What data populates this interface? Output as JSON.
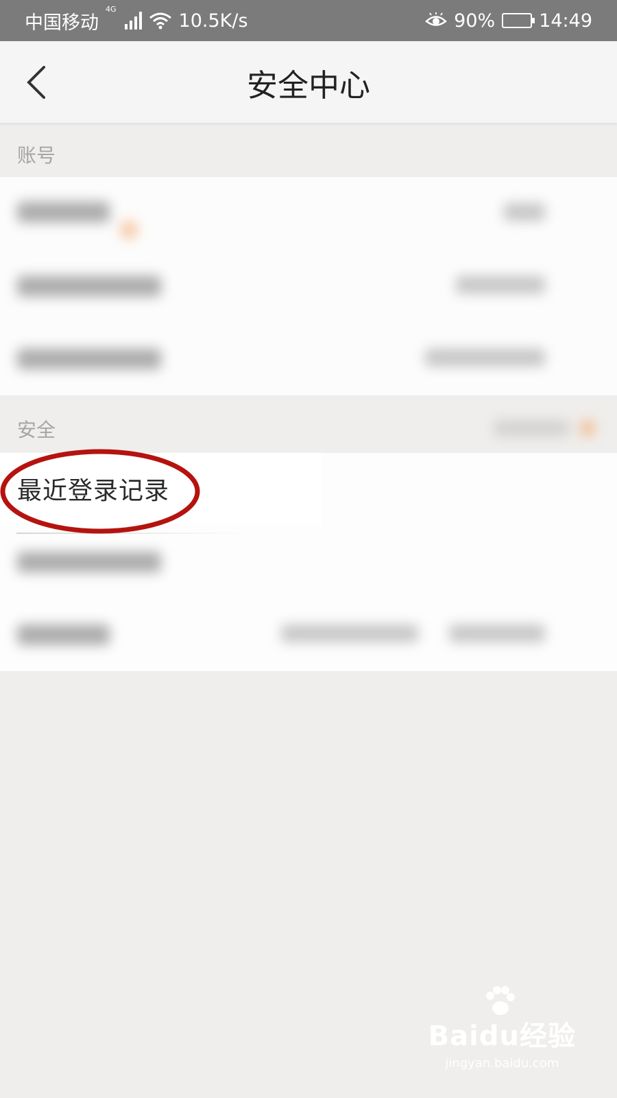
{
  "status_bar": {
    "carrier": "中国移动",
    "network_type": "4G",
    "speed": "10.5K/s",
    "battery_percent": "90%",
    "time": "14:49",
    "battery_level": 0.9
  },
  "header": {
    "title": "安全中心",
    "back_icon": "chevron-left-icon"
  },
  "sections": {
    "account": {
      "label": "账号"
    },
    "security": {
      "label": "安全",
      "highlighted_item": "最近登录记录"
    }
  },
  "annotation": {
    "color": "#b5130f"
  },
  "watermark": {
    "brand": "Baidu经验",
    "url": "jingyan.baidu.com"
  }
}
